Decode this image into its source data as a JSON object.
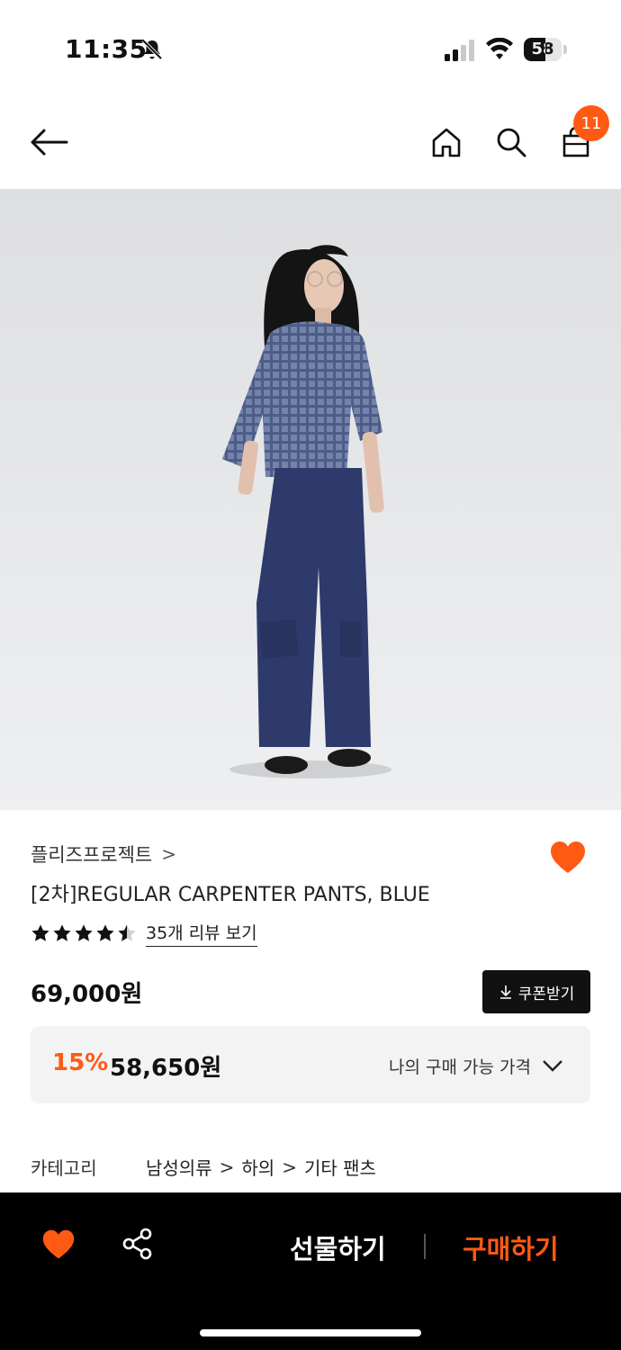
{
  "status_bar": {
    "time": "11:35",
    "battery": "58",
    "battery_level": 0.58
  },
  "header": {
    "cart_count": "11"
  },
  "product": {
    "brand": "플리즈프로젝트",
    "brand_chevron": ">",
    "title": "[2차]REGULAR CARPENTER PANTS, BLUE",
    "rating": 4.5,
    "review_link": "35개 리뷰 보기",
    "price": "69,000원",
    "coupon_label": "쿠폰받기",
    "best_price": {
      "discount": "15%",
      "price": "58,650원",
      "label": "나의 구매 가능 가격"
    },
    "category": {
      "label": "카테고리",
      "path": [
        "남성의류",
        "하의",
        "기타 팬츠"
      ],
      "separator": ">"
    }
  },
  "bottom_bar": {
    "gift_label": "선물하기",
    "buy_label": "구매하기"
  },
  "colors": {
    "accent": "#ff5a14",
    "dark": "#111111",
    "bottom_bg": "#000000"
  }
}
